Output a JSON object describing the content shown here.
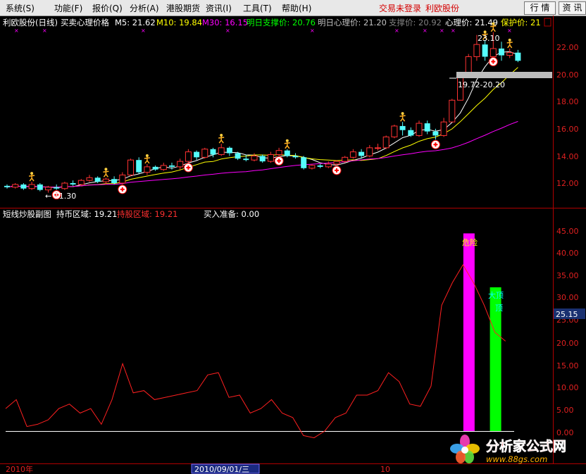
{
  "menu": {
    "items": [
      "系统(S)",
      "功能(F)",
      "报价(Q)",
      "分析(A)",
      "港股期货",
      "资讯(I)",
      "工具(T)",
      "帮助(H)"
    ],
    "status": "交易未登录",
    "stock": "利欧股份",
    "buttons": [
      "行 情",
      "资 讯"
    ]
  },
  "main_chart": {
    "title": "利欧股份(日线)",
    "indicator": "买卖心理价格",
    "ma": [
      {
        "label": "M5: 21.62",
        "color": "#ffffff"
      },
      {
        "label": "M10: 19.84",
        "color": "#ffff00"
      },
      {
        "label": "M30: 16.15",
        "color": "#ff00ff"
      }
    ],
    "extra": [
      {
        "label": "明日支撑价: 20.76",
        "color": "#00ff00"
      },
      {
        "label": "明日心理价: 21.20",
        "color": "#c0c0c0"
      },
      {
        "label": "支撑价: 20.92",
        "color": "#808080"
      },
      {
        "label": "心理价: 21.49",
        "color": "#ffffff"
      },
      {
        "label": "保护价: 21",
        "color": "#ffff00"
      }
    ],
    "y_ticks": [
      "22.00",
      "20.00",
      "18.00",
      "16.00",
      "14.00",
      "12.00"
    ],
    "low_label": "← 11.30",
    "high_label": "23.10",
    "zone_label": "19.72-20.20"
  },
  "sub_chart": {
    "title": "短线炒股副图",
    "items": [
      {
        "label": "持币区域: 19.21",
        "color": "#ffffff"
      },
      {
        "label": "持股区域: 19.21",
        "color": "#ff3030"
      },
      {
        "label": "买入准备: 0.00",
        "color": "#ffffff"
      }
    ],
    "y_ticks": [
      "45.00",
      "40.00",
      "35.00",
      "30.00",
      "25.00",
      "20.00",
      "15.00",
      "10.00",
      "5.00",
      "0.00"
    ],
    "current_value": "25.15",
    "danger_label": "危险",
    "top_label": "大顶",
    "top2_label": "顶"
  },
  "bottom": {
    "left_label": "2010年",
    "date_label": "2010/09/01/三",
    "month_label": "10"
  },
  "watermark": {
    "brand": "分析家公式网",
    "url": "www.88gs.com"
  },
  "chart_data": [
    {
      "type": "candlestick",
      "title": "利欧股份(日线)",
      "ylim": [
        11,
        23.5
      ],
      "candles": [
        [
          11.8,
          11.7,
          11.9,
          11.6
        ],
        [
          11.7,
          11.9,
          12.0,
          11.6
        ],
        [
          11.9,
          11.6,
          12.0,
          11.5
        ],
        [
          11.6,
          11.9,
          12.1,
          11.5
        ],
        [
          11.9,
          11.5,
          12.0,
          11.4
        ],
        [
          11.5,
          11.7,
          11.8,
          11.3
        ],
        [
          11.7,
          11.6,
          11.9,
          11.5
        ],
        [
          11.6,
          12.0,
          12.1,
          11.5
        ],
        [
          12.0,
          11.9,
          12.2,
          11.8
        ],
        [
          11.9,
          12.2,
          12.3,
          11.8
        ],
        [
          12.2,
          12.4,
          12.6,
          12.1
        ],
        [
          12.4,
          12.1,
          12.5,
          12.0
        ],
        [
          12.1,
          12.3,
          12.4,
          11.9
        ],
        [
          12.3,
          12.0,
          12.5,
          11.9
        ],
        [
          12.0,
          12.6,
          12.8,
          11.9
        ],
        [
          12.6,
          13.7,
          13.8,
          12.5
        ],
        [
          13.7,
          12.8,
          13.9,
          12.7
        ],
        [
          12.8,
          13.2,
          13.4,
          12.6
        ],
        [
          13.2,
          13.0,
          13.3,
          12.9
        ],
        [
          13.0,
          13.3,
          13.5,
          12.9
        ],
        [
          13.3,
          13.2,
          13.5,
          13.0
        ],
        [
          13.2,
          13.6,
          13.8,
          13.0
        ],
        [
          13.6,
          14.3,
          14.5,
          13.5
        ],
        [
          14.3,
          13.9,
          14.4,
          13.7
        ],
        [
          13.9,
          14.5,
          14.6,
          13.8
        ],
        [
          14.5,
          14.1,
          14.6,
          13.9
        ],
        [
          14.1,
          14.6,
          14.9,
          14.0
        ],
        [
          14.6,
          14.2,
          14.7,
          14.0
        ],
        [
          14.2,
          13.8,
          14.3,
          13.7
        ],
        [
          13.8,
          13.7,
          14.1,
          13.6
        ],
        [
          13.7,
          14.0,
          14.2,
          13.6
        ],
        [
          14.0,
          13.6,
          14.1,
          13.5
        ],
        [
          13.6,
          14.1,
          14.3,
          13.5
        ],
        [
          14.1,
          14.4,
          14.6,
          14.0
        ],
        [
          14.4,
          14.0,
          14.5,
          13.9
        ],
        [
          14.0,
          13.9,
          14.2,
          13.8
        ],
        [
          13.9,
          13.1,
          14.0,
          13.0
        ],
        [
          13.1,
          13.3,
          13.4,
          13.0
        ],
        [
          13.3,
          13.2,
          13.4,
          13.1
        ],
        [
          13.2,
          13.4,
          13.6,
          13.1
        ],
        [
          13.4,
          13.6,
          13.7,
          13.3
        ],
        [
          13.6,
          13.9,
          14.0,
          13.5
        ],
        [
          13.9,
          14.3,
          14.5,
          13.8
        ],
        [
          14.3,
          14.0,
          14.5,
          13.8
        ],
        [
          14.0,
          14.6,
          14.8,
          13.9
        ],
        [
          14.6,
          14.6,
          14.9,
          14.4
        ],
        [
          14.6,
          15.4,
          15.5,
          14.5
        ],
        [
          15.4,
          16.2,
          16.3,
          15.3
        ],
        [
          16.2,
          15.9,
          16.5,
          15.5
        ],
        [
          15.9,
          15.5,
          16.1,
          15.4
        ],
        [
          15.5,
          16.4,
          16.6,
          15.4
        ],
        [
          16.4,
          15.8,
          16.6,
          15.6
        ],
        [
          15.8,
          15.5,
          16.0,
          15.2
        ],
        [
          15.5,
          16.5,
          16.8,
          15.4
        ],
        [
          16.5,
          18.1,
          18.2,
          16.5
        ],
        [
          18.1,
          19.9,
          19.9,
          18.1
        ],
        [
          19.9,
          21.3,
          21.5,
          19.9
        ],
        [
          21.3,
          22.2,
          22.9,
          21.0
        ],
        [
          22.2,
          21.3,
          22.5,
          21.0
        ],
        [
          21.3,
          21.9,
          23.1,
          21.3
        ],
        [
          21.9,
          21.4,
          22.4,
          21.0
        ],
        [
          21.4,
          21.6,
          21.9,
          21.2
        ],
        [
          21.6,
          21.0,
          21.8,
          20.9
        ]
      ]
    },
    {
      "type": "line",
      "title": "短线炒股副图",
      "ylim": [
        0,
        48
      ],
      "values": [
        5,
        7,
        1,
        1.5,
        2.5,
        5,
        6,
        4,
        5,
        1.5,
        7,
        15,
        8.5,
        9,
        7,
        7.5,
        8,
        8.5,
        9,
        12.5,
        13,
        7.5,
        8,
        4,
        5,
        7,
        4,
        3,
        -1,
        -1.5,
        0,
        3,
        4,
        8,
        8,
        9,
        13,
        11,
        6,
        5.5,
        10,
        28,
        33,
        37,
        33,
        28,
        22,
        20
      ],
      "bars": [
        {
          "x_index": 43.5,
          "value": 44,
          "color": "#ff00ff",
          "label": "危险"
        },
        {
          "x_index": 46,
          "value": 32,
          "color": "#00ff00",
          "label": "大顶"
        }
      ]
    }
  ]
}
